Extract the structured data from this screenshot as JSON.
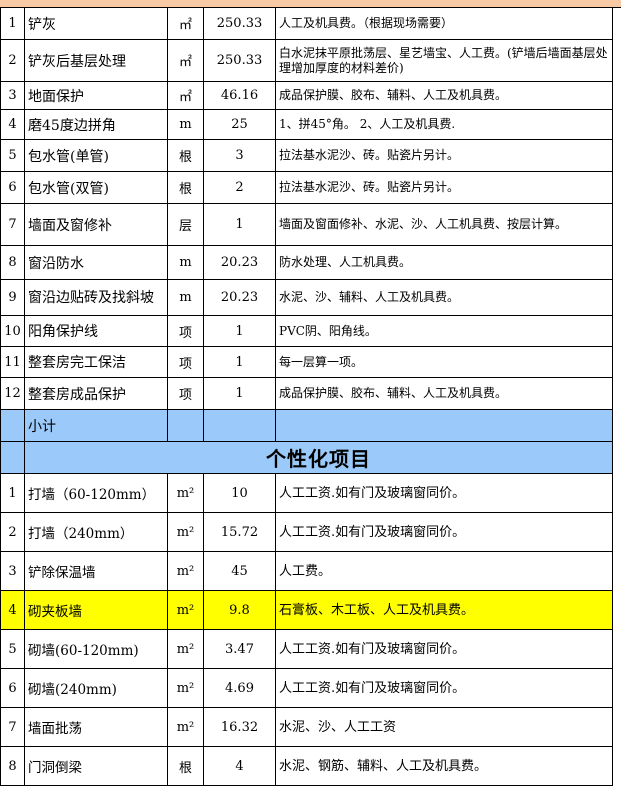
{
  "section1": {
    "rows": [
      {
        "no": "1",
        "name": "铲灰",
        "unit": "㎡",
        "qty": "250.33",
        "desc": "人工及机具费。（根据现场需要）"
      },
      {
        "no": "2",
        "name": "铲灰后基层处理",
        "unit": "㎡",
        "qty": "250.33",
        "desc": "白水泥抹平原批荡层、星艺墙宝、人工费。(铲墙后墙面基层处理增加厚度的材料差价)"
      },
      {
        "no": "3",
        "name": "地面保护",
        "unit": "㎡",
        "qty": "46.16",
        "desc": "成品保护膜、胶布、辅料、人工及机具费。"
      },
      {
        "no": "4",
        "name": "磨45度边拼角",
        "unit": "m",
        "qty": "25",
        "desc": "1、拼45°角。 2、人工及机具费."
      },
      {
        "no": "5",
        "name": "包水管(单管)",
        "unit": "根",
        "qty": "3",
        "desc": "拉法基水泥沙、砖。贴瓷片另计。"
      },
      {
        "no": "6",
        "name": "包水管(双管)",
        "unit": "根",
        "qty": "2",
        "desc": "拉法基水泥沙、砖。贴瓷片另计。"
      },
      {
        "no": "7",
        "name": "墙面及窗修补",
        "unit": "层",
        "qty": "1",
        "desc": "墙面及窗面修补、水泥、沙、人工机具费、按层计算。"
      },
      {
        "no": "8",
        "name": "窗沿防水",
        "unit": "m",
        "qty": "20.23",
        "desc": "防水处理、人工机具费。"
      },
      {
        "no": "9",
        "name": "窗沿边贴砖及找斜坡",
        "unit": "m",
        "qty": "20.23",
        "desc": "水泥、沙、辅料、人工及机具费。"
      },
      {
        "no": "10",
        "name": "阳角保护线",
        "unit": "项",
        "qty": "1",
        "desc": "PVC阴、阳角线。"
      },
      {
        "no": "11",
        "name": "整套房完工保洁",
        "unit": "项",
        "qty": "1",
        "desc": "每一层算一项。"
      },
      {
        "no": "12",
        "name": "整套房成品保护",
        "unit": "项",
        "qty": "1",
        "desc": "成品保护膜、胶布、辅料、人工及机具费。"
      }
    ],
    "subtotal_label": "小计"
  },
  "section2": {
    "title": "个性化项目",
    "rows": [
      {
        "no": "1",
        "name": "打墙（60-120mm）",
        "unit": "m²",
        "qty": "10",
        "desc": "人工工资.如有门及玻璃窗同价。"
      },
      {
        "no": "2",
        "name": "打墙（240mm）",
        "unit": "m²",
        "qty": "15.72",
        "desc": "人工工资.如有门及玻璃窗同价。"
      },
      {
        "no": "3",
        "name": "铲除保温墙",
        "unit": "m²",
        "qty": "45",
        "desc": "人工费。"
      },
      {
        "no": "4",
        "name": "砌夹板墙",
        "unit": "m²",
        "qty": "9.8",
        "desc": "石膏板、木工板、人工及机具费。"
      },
      {
        "no": "5",
        "name": "砌墙(60-120mm)",
        "unit": "m²",
        "qty": "3.47",
        "desc": "人工工资.如有门及玻璃窗同价。"
      },
      {
        "no": "6",
        "name": "砌墙(240mm)",
        "unit": "m²",
        "qty": "4.69",
        "desc": "人工工资.如有门及玻璃窗同价。"
      },
      {
        "no": "7",
        "name": "墙面批荡",
        "unit": "m²",
        "qty": "16.32",
        "desc": "水泥、沙、人工工资"
      },
      {
        "no": "8",
        "name": "门洞倒梁",
        "unit": "根",
        "qty": "4",
        "desc": "水泥、钢筋、辅料、人工及机具费。"
      }
    ]
  },
  "colors": {
    "header_strip": "#f7c9a4",
    "section_blue": "#9bc9f9",
    "highlight": "#ffff00"
  }
}
